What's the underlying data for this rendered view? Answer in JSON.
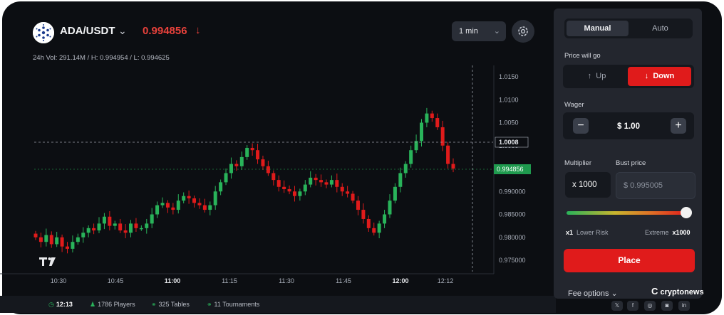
{
  "header": {
    "pair": "ADA/USDT",
    "price": "0.994856",
    "price_arrow": "↓",
    "stats": "24h Vol: 291.14M / H: 0.994954 / L: 0.994625",
    "interval": "1 min"
  },
  "chart_data": {
    "type": "candlestick",
    "y_ticks": [
      "0.975000",
      "0.980000",
      "0.985000",
      "0.990000",
      "0.995000",
      "1.0000",
      "1.0050",
      "1.0100",
      "1.0150"
    ],
    "x_ticks": [
      "10:30",
      "10:45",
      "11:00",
      "11:15",
      "11:30",
      "11:45",
      "12:00",
      "12:12"
    ],
    "x_ticks_bold": [
      "11:00",
      "12:00"
    ],
    "crosshair_label": "1.0008",
    "current_price_label": "0.994856",
    "ylim": [
      0.9725,
      1.0175
    ],
    "colors": {
      "up": "#29b35a",
      "down": "#e01b1b"
    },
    "close_path": [
      0.98,
      0.979,
      0.9805,
      0.9785,
      0.98,
      0.978,
      0.9775,
      0.979,
      0.98,
      0.981,
      0.982,
      0.9815,
      0.983,
      0.9845,
      0.9825,
      0.983,
      0.9815,
      0.981,
      0.983,
      0.982,
      0.982,
      0.983,
      0.985,
      0.987,
      0.9875,
      0.9865,
      0.986,
      0.988,
      0.989,
      0.9885,
      0.9875,
      0.987,
      0.986,
      0.987,
      0.99,
      0.992,
      0.994,
      0.996,
      0.9955,
      0.9975,
      0.9995,
      0.999,
      0.997,
      0.9955,
      0.994,
      0.9925,
      0.991,
      0.9905,
      0.99,
      0.989,
      0.99,
      0.9915,
      0.993,
      0.9925,
      0.992,
      0.9915,
      0.9925,
      0.991,
      0.99,
      0.9895,
      0.988,
      0.986,
      0.984,
      0.982,
      0.981,
      0.983,
      0.985,
      0.988,
      0.991,
      0.994,
      0.996,
      0.999,
      1.001,
      1.005,
      1.007,
      1.006,
      1.004,
      1.0,
      0.996,
      0.995
    ]
  },
  "footer": {
    "time": "12:13",
    "players": "1786 Players",
    "tables": "325 Tables",
    "tournaments": "11 Tournaments",
    "social": [
      "𝕏",
      "f",
      "◎",
      "◙",
      "in"
    ]
  },
  "panel": {
    "tab_manual": "Manual",
    "tab_auto": "Auto",
    "price_will_go": "Price will go",
    "up": "Up",
    "down": "Down",
    "wager_label": "Wager",
    "wager_value": "$ 1.00",
    "multiplier_label": "Multiplier",
    "multiplier_value": "x 1000",
    "bust_label": "Bust price",
    "bust_value": "$ 0.995005",
    "slider_level": 1.0,
    "risk_min": "x1",
    "risk_min_label": "Lower Risk",
    "risk_max_label": "Extreme",
    "risk_max": "x1000",
    "place": "Place",
    "fee_options": "Fee options",
    "brand": "cryptonews"
  },
  "icons": [
    "cardano-logo-icon",
    "chevron-down-icon",
    "arrow-down-icon",
    "gear-icon",
    "tradingview-logo-icon",
    "clock-icon",
    "users-icon",
    "link-icon",
    "arrow-up-icon",
    "minus-icon",
    "plus-icon",
    "cryptonews-logo-icon"
  ]
}
